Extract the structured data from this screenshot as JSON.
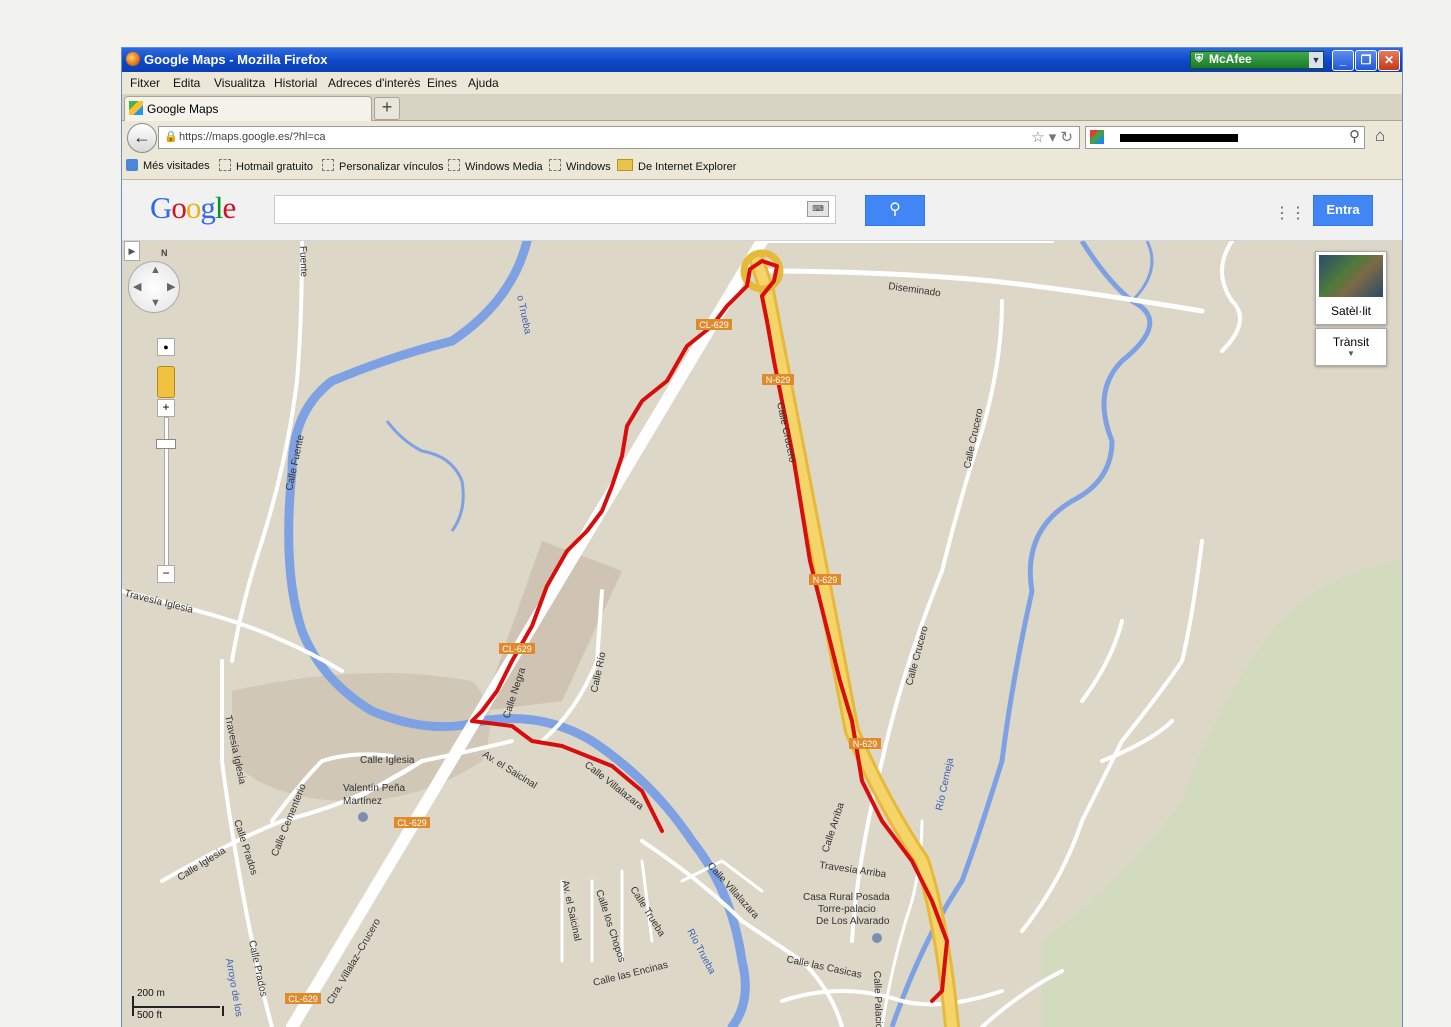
{
  "window": {
    "title": "Google Maps - Mozilla Firefox",
    "mcafee": "McAfee"
  },
  "menu": [
    "Fitxer",
    "Edita",
    "Visualitza",
    "Historial",
    "Adreces d'interès",
    "Eines",
    "Ajuda"
  ],
  "tab": {
    "label": "Google Maps"
  },
  "url": "https://maps.google.es/?hl=ca",
  "bookmarks": [
    "Més visitades",
    "Hotmail gratuito",
    "Personalizar vínculos",
    "Windows Media",
    "Windows",
    "De Internet Explorer"
  ],
  "google": {
    "logo": "Google",
    "signin": "Entra"
  },
  "map_controls": {
    "north": "N",
    "satellite": "Satèl·lit",
    "traffic": "Trànsit",
    "scale_m": "200 m",
    "scale_ft": "500 ft"
  },
  "map_labels": {
    "diseminado": "Diseminado",
    "trueba_top": "o Trueba",
    "fuente_top": "Fuente",
    "calle_fuente": "Calle Fuente",
    "calle_crucero_a": "Calle Crucero",
    "calle_crucero_b": "Calle Crucero",
    "calle_crucero_road": "Calle Crucero",
    "travesia_iglesia_top": "Travesía Iglesia",
    "travesia_iglesia_left": "Travesía Iglesia",
    "calle_negra": "Calle Negra",
    "calle_rio": "Calle Río",
    "calle_iglesia": "Calle Iglesia",
    "calle_iglesia_b": "Calle Iglesia",
    "calle_cementerio": "Calle Cementerio",
    "calle_prados": "Calle Prados",
    "calle_prados_b": "Calle Prados",
    "valentin": "Valentín Peña",
    "martinez": "Martínez",
    "av_saicinal": "Av. el Saicinal",
    "av_saicinal_b": "Av. el Saicinal",
    "calle_villalazara": "Calle Villalazara",
    "calle_villalazara_b": "Calle Villalazara",
    "rio_trueba": "Río Trueba",
    "rio_cerneja": "Río Cerneja",
    "calle_los_chopos": "Calle los Chopos",
    "calle_las_encinas": "Calle las Encinas",
    "calle_trueba": "Calle Trueba",
    "calle_arriba": "Calle Arriba",
    "travesia_arriba": "Travesía Arriba",
    "casa_rural1": "Casa Rural Posada",
    "casa_rural2": "Torre-palacio",
    "casa_rural3": "De Los Alvarado",
    "calle_las_casicas": "Calle las Casicas",
    "calle_palacio": "Calle Palacio",
    "ctra": "Ctra. Villalaz–Crucero",
    "arroyo": "Arroyo de los",
    "cl629": "CL-629",
    "n629": "N-629"
  }
}
